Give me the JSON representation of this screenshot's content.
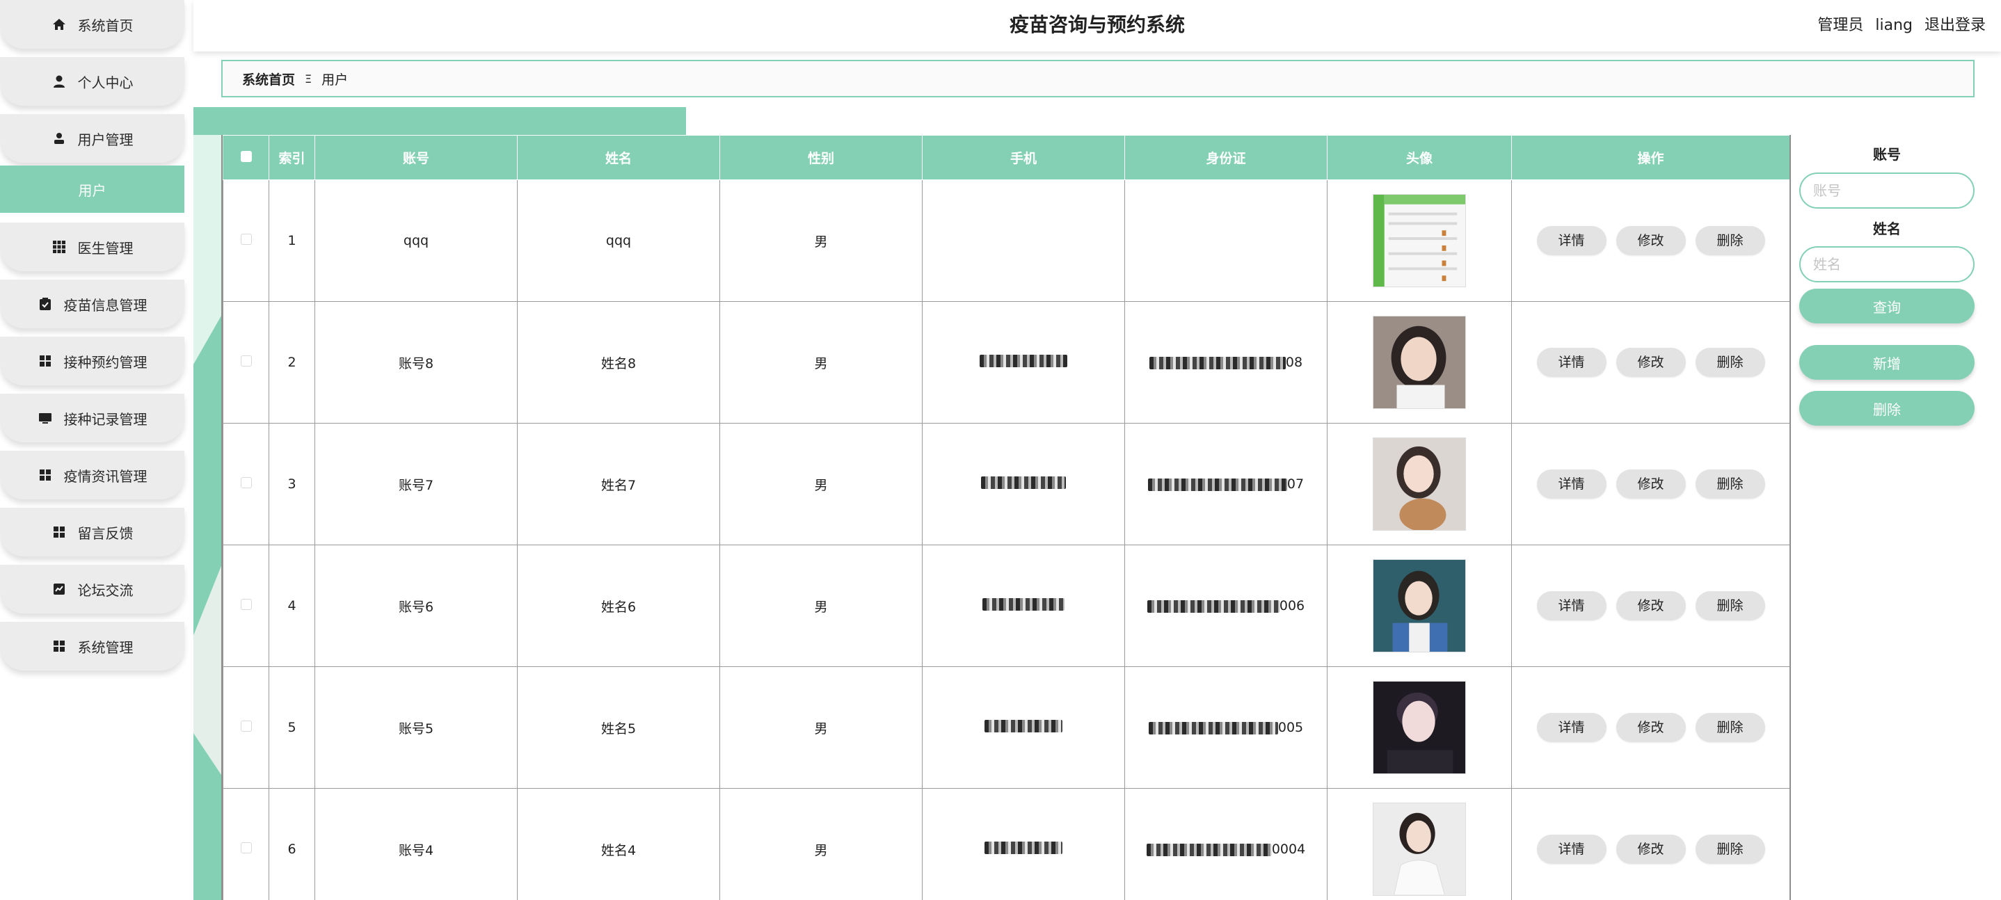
{
  "app": {
    "title": "疫苗咨询与预约系统",
    "role": "管理员",
    "username": "liang",
    "logout_label": "退出登录"
  },
  "sidebar": {
    "items": [
      {
        "label": "系统首页",
        "icon": "home-icon"
      },
      {
        "label": "个人中心",
        "icon": "person-icon"
      },
      {
        "label": "用户管理",
        "icon": "user-icon"
      },
      {
        "label": "医生管理",
        "icon": "grid-icon"
      },
      {
        "label": "疫苗信息管理",
        "icon": "clipboard-check-icon"
      },
      {
        "label": "接种预约管理",
        "icon": "apps-icon"
      },
      {
        "label": "接种记录管理",
        "icon": "monitor-icon"
      },
      {
        "label": "疫情资讯管理",
        "icon": "apps-icon"
      },
      {
        "label": "留言反馈",
        "icon": "apps-icon"
      },
      {
        "label": "论坛交流",
        "icon": "chart-icon"
      },
      {
        "label": "系统管理",
        "icon": "apps-icon"
      }
    ],
    "active_sub": "用户"
  },
  "breadcrumb": {
    "home": "系统首页",
    "separator": "Ξ",
    "current": "用户"
  },
  "table": {
    "headers": [
      "索引",
      "账号",
      "姓名",
      "性别",
      "手机",
      "身份证",
      "头像",
      "操作"
    ],
    "rows": [
      {
        "index": "1",
        "account": "qqq",
        "name": "qqq",
        "gender": "男",
        "phone": "",
        "id_card": "",
        "avatar": "screenshot-thumbnail"
      },
      {
        "index": "2",
        "account": "账号8",
        "name": "姓名8",
        "gender": "男",
        "phone": "",
        "id_card": "08",
        "avatar": "portrait-photo"
      },
      {
        "index": "3",
        "account": "账号7",
        "name": "姓名7",
        "gender": "男",
        "phone": "",
        "id_card": "07",
        "avatar": "portrait-photo"
      },
      {
        "index": "4",
        "account": "账号6",
        "name": "姓名6",
        "gender": "男",
        "phone": "",
        "id_card": "006",
        "avatar": "portrait-photo"
      },
      {
        "index": "5",
        "account": "账号5",
        "name": "姓名5",
        "gender": "男",
        "phone": "",
        "id_card": "005",
        "avatar": "portrait-photo"
      },
      {
        "index": "6",
        "account": "账号4",
        "name": "姓名4",
        "gender": "男",
        "phone": "",
        "id_card": "0004",
        "avatar": "portrait-photo"
      }
    ],
    "actions": {
      "detail": "详情",
      "edit": "修改",
      "delete": "删除"
    }
  },
  "search": {
    "account_label": "账号",
    "account_placeholder": "账号",
    "name_label": "姓名",
    "name_placeholder": "姓名",
    "query_button": "查询",
    "add_button": "新增",
    "delete_button": "删除"
  },
  "colors": {
    "accent": "#84d0b4",
    "button_gray": "#e3e3e3",
    "nav_gray": "#ececec"
  }
}
